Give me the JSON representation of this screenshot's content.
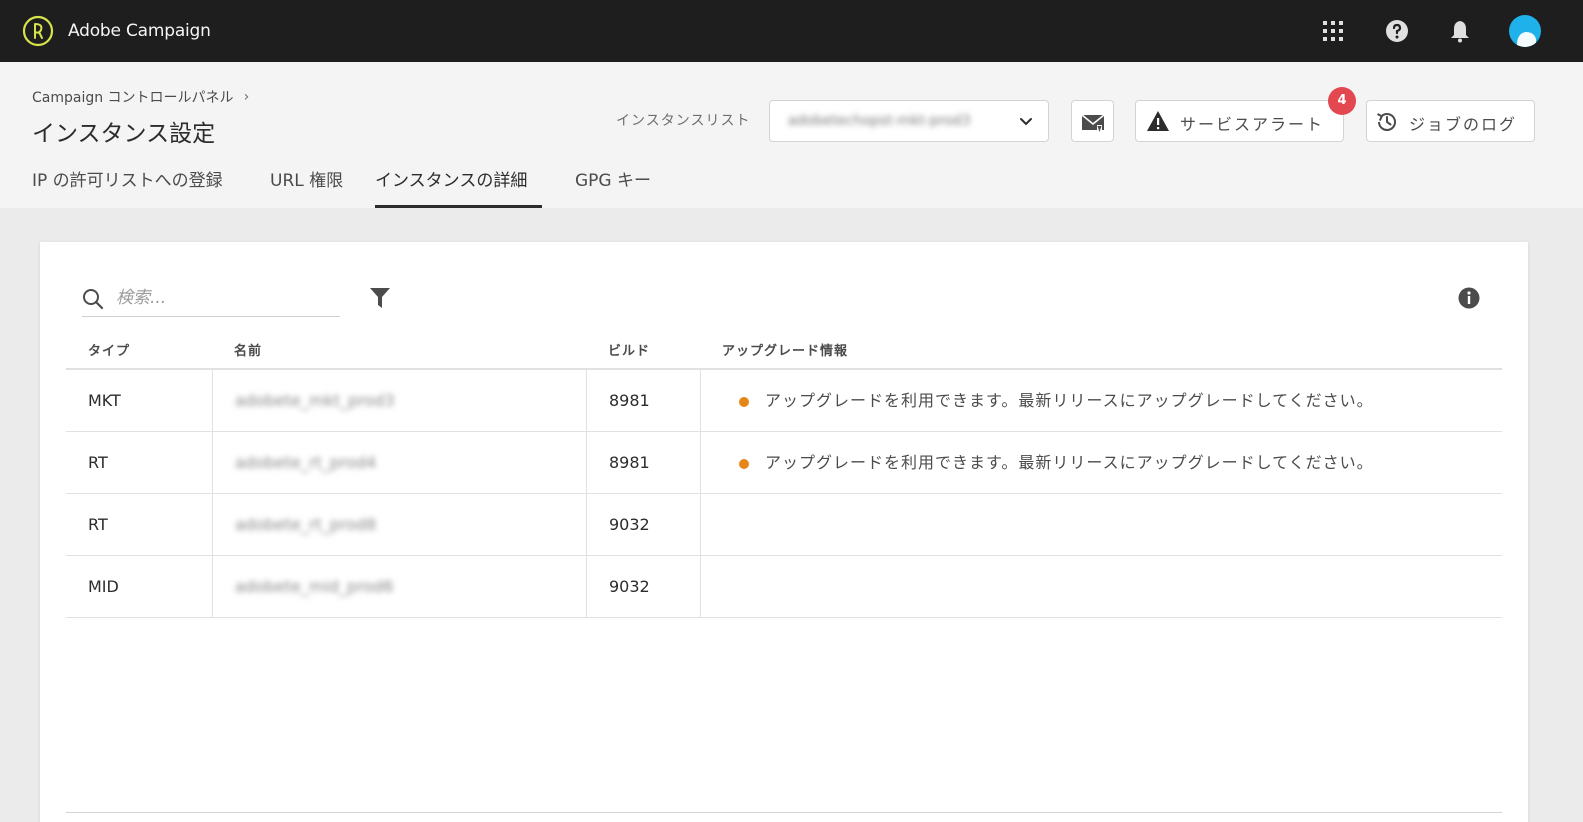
{
  "app": {
    "title": "Adobe Campaign"
  },
  "header": {
    "breadcrumb": "Campaign コントロールパネル",
    "page_title": "インスタンス設定",
    "instance_list_label": "インスタンスリスト",
    "instance_selected": "adobetechopst-mkt-prod3",
    "service_alert_label": "サービスアラート",
    "service_alert_count": "4",
    "job_log_label": "ジョブのログ"
  },
  "tabs": [
    {
      "label": "IP の許可リストへの登録",
      "active": false
    },
    {
      "label": "URL 権限",
      "active": false
    },
    {
      "label": "インスタンスの詳細",
      "active": true
    },
    {
      "label": "GPG キー",
      "active": false
    }
  ],
  "search": {
    "placeholder": "検索..."
  },
  "table": {
    "columns": [
      "タイプ",
      "名前",
      "ビルド",
      "アップグレード情報"
    ],
    "rows": [
      {
        "type": "MKT",
        "name": "adobete_mkt_prod3",
        "build": "8981",
        "upgrade": "アップグレードを利用できます。最新リリースにアップグレードしてください。"
      },
      {
        "type": "RT",
        "name": "adobete_rt_prod4",
        "build": "8981",
        "upgrade": "アップグレードを利用できます。最新リリースにアップグレードしてください。"
      },
      {
        "type": "RT",
        "name": "adobete_rt_prod8",
        "build": "9032",
        "upgrade": ""
      },
      {
        "type": "MID",
        "name": "adobete_mid_prod6",
        "build": "9032",
        "upgrade": ""
      }
    ]
  },
  "colors": {
    "topbar": "#1e1e1e",
    "avatar": "#1fb1e9",
    "badge": "#e34850",
    "warning_dot": "#e68619",
    "logo": "#d7e34b"
  },
  "icons": {
    "logo": "adobe-campaign-logo-icon",
    "apps": "app-grid-icon",
    "help": "help-icon",
    "notifications": "bell-icon",
    "email": "email-alert-icon",
    "alert": "warning-triangle-icon",
    "log": "history-clock-icon",
    "search": "search-icon",
    "filter": "filter-icon",
    "info": "info-icon"
  }
}
